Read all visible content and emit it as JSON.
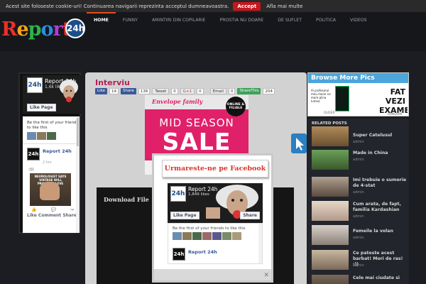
{
  "cookie": {
    "message": "Acest site foloseste cookie-uri! Continuarea navigarii reprezinta acceptul dumneavoastra.",
    "accept_label": "Accept",
    "more_label": "Afla mai multe"
  },
  "header": {
    "logo_text": "Report",
    "logo_badge": "24h",
    "nav": [
      "HOME",
      "FUNNY",
      "AMINTIRI DIN COPILARIE",
      "PROSTIA NU DOARE",
      "DE SUFLET",
      "POLITICA",
      "VIDEOS"
    ]
  },
  "sidebar_fb": {
    "page_name": "Report 24h",
    "likes": "1,6k likes",
    "like_button": "Like Page",
    "friends_text": "Be the first of your friends to like this",
    "post_author": "Report 24h",
    "post_time": "2 hrs",
    "post_caption": ":)))",
    "post_image_caption": "NEUROLOGIST SAYS VINTAGE WILL PROBABLY LOVE",
    "actions": [
      "Like",
      "Comment",
      "Share"
    ]
  },
  "main": {
    "title": "Interviu",
    "share": [
      {
        "label": "Like",
        "count": "14",
        "color": "#3b5998"
      },
      {
        "label": "Share",
        "count": "136",
        "color": "#3b5998"
      },
      {
        "label": "Tweet",
        "count": "0",
        "color": "#e8e8e8"
      },
      {
        "label": "G+1",
        "count": "0",
        "color": "#e8e8e8"
      },
      {
        "label": "Email",
        "count": "0",
        "color": "#e8e8e8"
      },
      {
        "label": "ShareThis",
        "count": "204",
        "color": "#3ca25a"
      }
    ],
    "promo": {
      "brand": "Envelope family",
      "badge": "ONLINE & FILIALE",
      "line1": "MID SEASON",
      "line2": "SALE"
    },
    "download_label": "Download File"
  },
  "browse": {
    "title": "Browse More Pics",
    "img1_caption": "Ai profesorul meu mane ne mare plina lumea",
    "img3_text": "FAT VEZI EXAMEN",
    "older_label": "OLDER",
    "random_label": "RANDOM"
  },
  "related": {
    "title": "RELATED POSTS",
    "items": [
      {
        "title": "Super Catelusul",
        "author": "admin"
      },
      {
        "title": "Made in China",
        "author": "admin"
      },
      {
        "title": "Imi trebuie o sumerie de 4-stat",
        "author": "admin"
      },
      {
        "title": "Cum arata, de fapt, familia Kardashian",
        "author": "admin"
      },
      {
        "title": "Femeile la volan",
        "author": "admin"
      },
      {
        "title": "Ce pateste acest barbat! Mori de ras! :))",
        "author": "admin"
      },
      {
        "title": "Cele mai ciudate si",
        "author": ""
      }
    ]
  },
  "popup": {
    "title": "Urmareste-ne pe Facebook",
    "page_name": "Report 24h",
    "likes": "1,849 likes",
    "like_button": "Like Page",
    "share_button": "Share",
    "friends_text": "Be the first of your friends to like this",
    "post_author": "Report 24h",
    "close_label": "✕"
  }
}
